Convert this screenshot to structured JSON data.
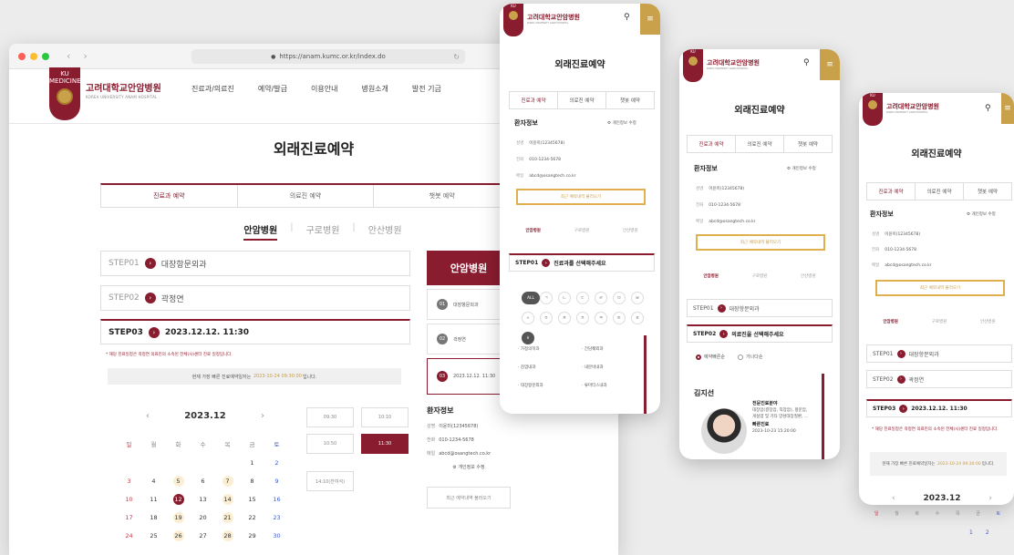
{
  "browser": {
    "url": "https://anam.kumc.or.kr/index.do",
    "back": "‹",
    "forward": "›",
    "reload": "↻",
    "lock": "🔒"
  },
  "site": {
    "logo_badge": "KU\nMEDICINE",
    "logo_ko": "고려대학교안암병원",
    "logo_en": "KOREA UNIVERSITY ANAM HOSPITAL",
    "nav": [
      "진료과/의료진",
      "예약/발급",
      "이용안내",
      "병원소개",
      "발전 기금"
    ]
  },
  "desktop": {
    "page_title": "외래진료예약",
    "tabs": [
      "진료과 예약",
      "의료진 예약",
      "챗봇 예약"
    ],
    "campus": [
      "안암병원",
      "구로병원",
      "안산병원"
    ],
    "steps": [
      {
        "num": "STEP01",
        "value": "대장항문외과"
      },
      {
        "num": "STEP02",
        "value": "곽정연"
      },
      {
        "num": "STEP03",
        "value": "2023.12.12. 11:30"
      }
    ],
    "notice": "* 해당 진료일정은 곽정연 의료진의 소속된 전체(시)센터 진료 일정입니다.",
    "earliest_prefix": "현재 가장 빠른 진료예약일자는",
    "earliest_date": "2023-10-24 09:30:00",
    "earliest_suffix": "입니다.",
    "calendar": {
      "month": "2023.12",
      "prev": "‹",
      "next": "›",
      "dow": [
        "일",
        "월",
        "화",
        "수",
        "목",
        "금",
        "토"
      ],
      "rows": [
        [
          "",
          "",
          "",
          "",
          "",
          "1",
          "2"
        ],
        [
          "3",
          "4",
          "5",
          "6",
          "7",
          "8",
          "9"
        ],
        [
          "10",
          "11",
          "12",
          "13",
          "14",
          "15",
          "16"
        ],
        [
          "17",
          "18",
          "19",
          "20",
          "21",
          "22",
          "23"
        ],
        [
          "24",
          "25",
          "26",
          "27",
          "28",
          "29",
          "30"
        ]
      ],
      "available_days": [
        "5",
        "7",
        "14",
        "19",
        "21",
        "26",
        "28"
      ],
      "selected_day": "12"
    },
    "times": [
      "09:30",
      "10:10",
      "10:50",
      "11:30",
      "14:10(잔여석)"
    ],
    "selected_time": "11:30",
    "side": {
      "title": "안암병원",
      "steps": [
        {
          "n": "01",
          "label": "대장항문외과"
        },
        {
          "n": "02",
          "label": "곽정연"
        },
        {
          "n": "03",
          "label": "2023.12.12. 11:30"
        }
      ],
      "patient_heading": "환자정보",
      "name_label": "성명",
      "name_value": "이윤미(12345678)",
      "phone_label": "전화",
      "phone_value": "010-1234-5678",
      "email_label": "메일",
      "email_value": "abcd@osangtech.co.kr",
      "edit_label": "개인정보 수정",
      "recent_label": "최근 예약내역 불러오기"
    }
  },
  "phone1": {
    "title": "외래진료예약",
    "tabs": [
      "진료과 예약",
      "의료진 예약",
      "챗봇 예약"
    ],
    "patient_heading": "환자정보",
    "edit_label": "개인정보 수정",
    "name_label": "성명",
    "name_value": "이윤미(12345678)",
    "phone_label": "전화",
    "phone_value": "010-1234-5678",
    "email_label": "메일",
    "email_value": "abcd@osangtech.co.kr",
    "recent_label": "최근 예약내역 불러오기",
    "campus": [
      "안암병원",
      "구로병원",
      "안산병원"
    ],
    "step": {
      "num": "STEP01",
      "value": "진료과를 선택해주세요"
    },
    "consonants": [
      "ALL",
      "ㄱ",
      "ㄴ",
      "ㄷ",
      "ㄹ",
      "ㅁ",
      "ㅂ",
      "ㅅ",
      "ㅇ",
      "ㅈ",
      "ㅊ",
      "ㅋ",
      "ㅌ",
      "ㅍ",
      "ㅎ"
    ],
    "departments": [
      "가정의학과",
      "간담췌외과",
      "감염내과",
      "내분비내과",
      "대장항문외과",
      "류마티스내과"
    ]
  },
  "phone2": {
    "title": "외래진료예약",
    "tabs": [
      "진료과 예약",
      "의료진 예약",
      "챗봇 예약"
    ],
    "patient_heading": "환자정보",
    "edit_label": "개인정보 수정",
    "name_label": "성명",
    "name_value": "이윤미(12345678)",
    "phone_label": "전화",
    "phone_value": "010-1234-5678",
    "email_label": "메일",
    "email_value": "abcd@osangtech.co.kr",
    "recent_label": "최근 예약내역 불러오기",
    "campus": [
      "안암병원",
      "구로병원",
      "안산병원"
    ],
    "step1": {
      "num": "STEP01",
      "value": "대장항문외과"
    },
    "step2": {
      "num": "STEP02",
      "value": "의료진을 선택해주세요"
    },
    "radio": [
      "예약빠른순",
      "가나다순"
    ],
    "doctor_name": "김지선",
    "field_heading": "전문진료분야",
    "field_text": "대장암(결장암, 직장암), 항문암, 게실염 및 기타 양성대장질환, ...",
    "fast_heading": "빠른진료",
    "fast_value": "2023-10-23 15:20:00"
  },
  "phone3": {
    "title": "외래진료예약",
    "tabs": [
      "진료과 예약",
      "의료진 예약",
      "챗봇 예약"
    ],
    "patient_heading": "환자정보",
    "edit_label": "개인정보 수정",
    "name_label": "성명",
    "name_value": "이윤미(12345678)",
    "phone_label": "전화",
    "phone_value": "010-1234-5678",
    "email_label": "메일",
    "email_value": "abcd@osangtech.co.kr",
    "recent_label": "최근 예약내역 불러오기",
    "campus": [
      "안암병원",
      "구로병원",
      "안산병원"
    ],
    "steps": [
      {
        "num": "STEP01",
        "value": "대장항문외과"
      },
      {
        "num": "STEP02",
        "value": "곽정연"
      },
      {
        "num": "STEP03",
        "value": "2023.12.12. 11:30"
      }
    ],
    "notice": "* 해당 진료일정은 곽정연 의료진의 소속된 전체(시)센터 진료 일정입니다.",
    "earliest_prefix": "현재 가장 빠른 진료예약일자는",
    "earliest_date": "2023-10-24 09:30:00",
    "earliest_suffix": "입니다.",
    "month": "2023.12",
    "prev": "‹",
    "next": "›",
    "dow": [
      "일",
      "월",
      "화",
      "수",
      "목",
      "금",
      "토"
    ],
    "first_row": [
      "1",
      "2"
    ]
  },
  "icons": {
    "search": "search-icon",
    "menu": "hamburger-menu-icon",
    "user": "user-icon"
  },
  "colors": {
    "brand": "#8a1c2f",
    "gold": "#c9a14a",
    "available": "#fbeed2",
    "sunday": "#c73a4c",
    "saturday": "#3b5bd4"
  }
}
